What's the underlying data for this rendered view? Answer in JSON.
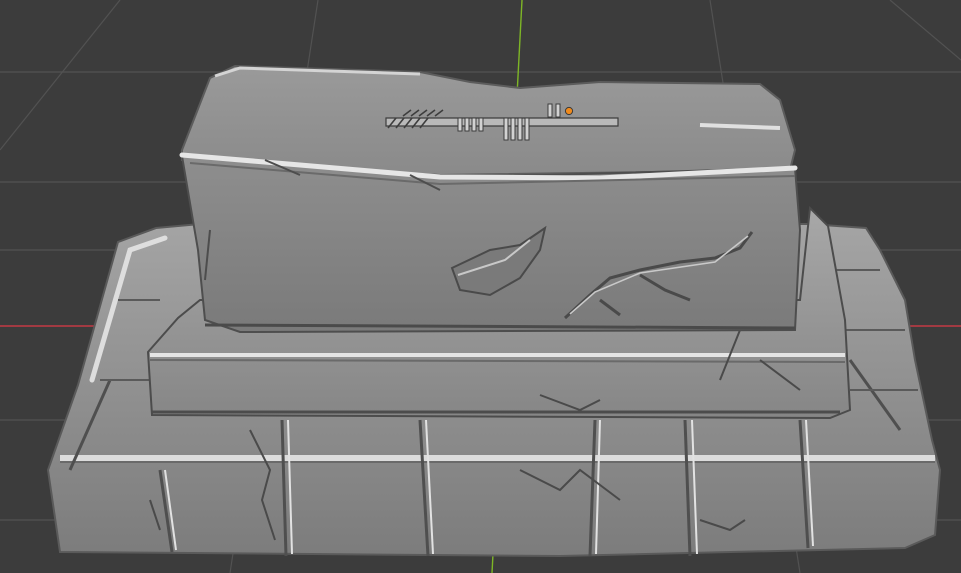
{
  "viewport": {
    "background": "#3c3c3c",
    "grid_color": "#525252",
    "axis_x_color": "#c43a44",
    "axis_y_color": "#7eb626",
    "origin_color": "#f08a1c",
    "mesh": {
      "type": "sculpted stone pedestal",
      "tiers": [
        "top-slab",
        "middle-slab",
        "brick-base"
      ],
      "surface_color": "#8f8f8f",
      "highlight_color": "#dcdcdc",
      "shadow_color": "#4e4e4e"
    },
    "icons": [
      "origin-icon",
      "bevel-mark-icon",
      "notch-group-icon"
    ]
  }
}
